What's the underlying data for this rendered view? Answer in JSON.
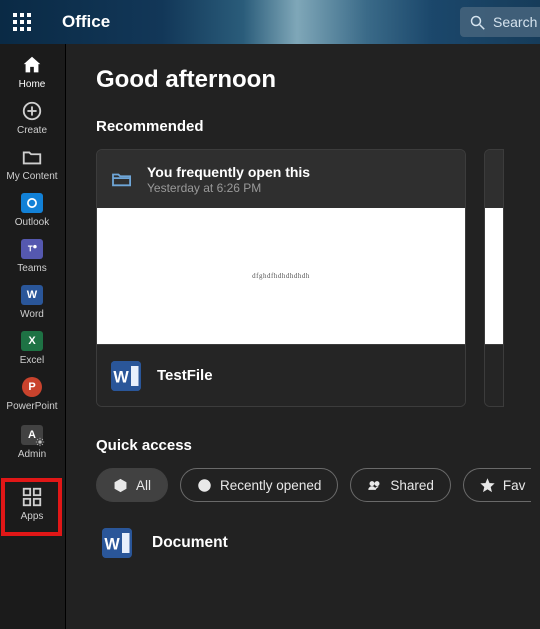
{
  "header": {
    "brand": "Office",
    "search_placeholder": "Search"
  },
  "sidebar": {
    "items": [
      {
        "id": "home",
        "label": "Home"
      },
      {
        "id": "create",
        "label": "Create"
      },
      {
        "id": "my-content",
        "label": "My Content"
      },
      {
        "id": "outlook",
        "label": "Outlook",
        "glyph": "o⃕"
      },
      {
        "id": "teams",
        "label": "Teams"
      },
      {
        "id": "word",
        "label": "Word",
        "glyph": "W"
      },
      {
        "id": "excel",
        "label": "Excel",
        "glyph": "X"
      },
      {
        "id": "powerpoint",
        "label": "PowerPoint",
        "glyph": "P"
      },
      {
        "id": "admin",
        "label": "Admin",
        "glyph": "A"
      },
      {
        "id": "apps",
        "label": "Apps"
      }
    ]
  },
  "main": {
    "greeting": "Good afternoon",
    "recommended": {
      "title": "Recommended",
      "card": {
        "reason": "You frequently open this",
        "when": "Yesterday at 6:26 PM",
        "preview_text": "dfghdfhdhdhdhdh",
        "file_name": "TestFile"
      }
    },
    "quick_access": {
      "title": "Quick access",
      "pills": [
        {
          "id": "all",
          "label": "All"
        },
        {
          "id": "recent",
          "label": "Recently opened"
        },
        {
          "id": "shared",
          "label": "Shared"
        },
        {
          "id": "fav",
          "label": "Fav"
        }
      ],
      "doc": {
        "name": "Document"
      }
    }
  },
  "highlight": {
    "target": "admin"
  }
}
